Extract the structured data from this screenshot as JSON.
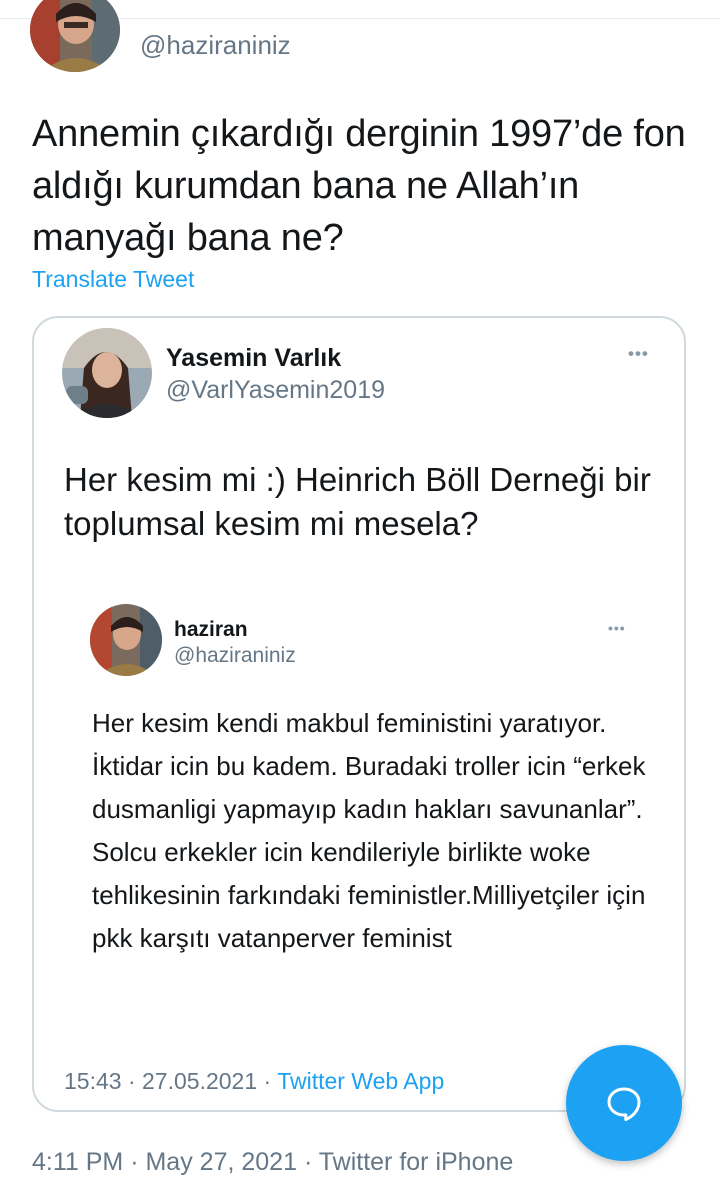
{
  "tweet": {
    "handle": "@haziraniniz",
    "text": "Annemin çıkardığı derginin 1997’de fon aldığı kurumdan bana ne Allah’ın manyağı bana ne?",
    "translate_label": "Translate Tweet",
    "time": "4:11 PM",
    "date": "May 27, 2021",
    "source": "Twitter for iPhone"
  },
  "quoted": {
    "name": "Yasemin Varlık",
    "handle": "@VarlYasemin2019",
    "text": "Her kesim mi :) Heinrich Böll Derneği bir toplumsal kesim mi mesela?",
    "time": "15:43",
    "date": "27.05.2021",
    "source": "Twitter Web App",
    "inner": {
      "name": "haziran",
      "handle": "@haziraniniz",
      "text": "Her kesim kendi makbul feministini yaratıyor. İktidar icin bu kadem. Buradaki troller icin “erkek dusmanligi yapmayıp kadın hakları savunanlar”.  Solcu erkekler icin kendileriyle birlikte woke tehlikesinin farkındaki feministler.Milliyetçiler için pkk karşıtı vatanperver feminist"
    }
  },
  "more_label": "•••",
  "separator": "·",
  "icons": {
    "compose": "compose-reply-icon",
    "more": "more-options-icon"
  },
  "colors": {
    "accent": "#1da1f2",
    "secondary_text": "#657786",
    "border": "#cfd9de"
  }
}
